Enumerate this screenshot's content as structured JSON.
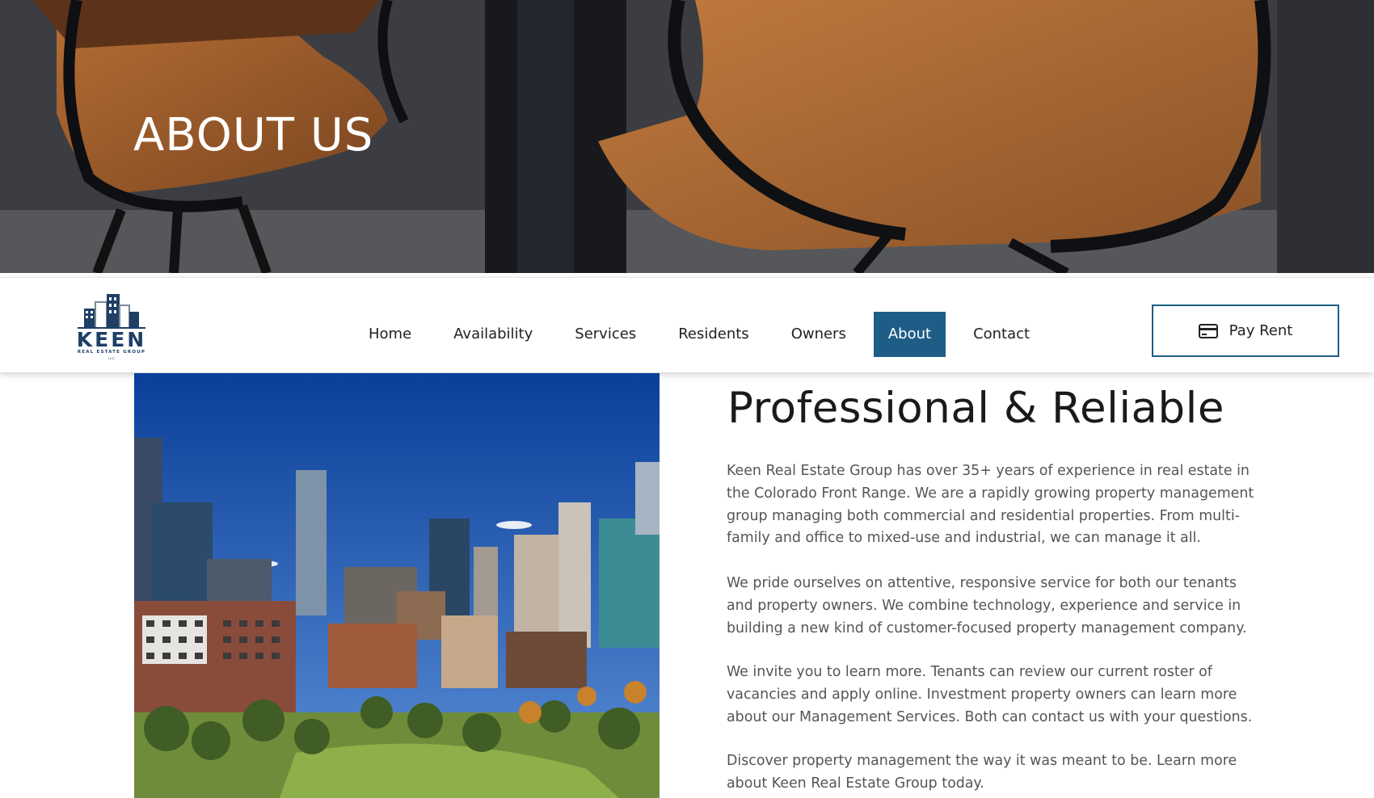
{
  "hero": {
    "title": "ABOUT US"
  },
  "nav": {
    "logo": {
      "word": "KEEN",
      "subtitle": "REAL ESTATE GROUP",
      "suffix": "LLC"
    },
    "items": [
      {
        "label": "Home",
        "active": false
      },
      {
        "label": "Availability",
        "active": false
      },
      {
        "label": "Services",
        "active": false
      },
      {
        "label": "Residents",
        "active": false
      },
      {
        "label": "Owners",
        "active": false
      },
      {
        "label": "About",
        "active": true
      },
      {
        "label": "Contact",
        "active": false
      }
    ],
    "pay_rent": {
      "label": "Pay Rent",
      "icon": "credit-card-icon"
    }
  },
  "about": {
    "title": "Professional & Reliable",
    "paragraphs": [
      "Keen Real Estate Group has over 35+ years of experience in real estate in the Colorado Front Range. We are a rapidly growing property management group managing both commercial and residential properties. From multi-family and office to mixed-use and industrial, we can manage it all.",
      "We pride ourselves on attentive, responsive service for both our tenants and property owners. We combine technology, experience and service in building a new kind of customer-focused property management company.",
      "We invite you to learn more. Tenants can review our current roster of vacancies and apply online. Investment property owners can learn more about our Management Services. Both can contact us with your questions.",
      "Discover property management the way it was meant to be. Learn more about Keen Real Estate Group today."
    ]
  },
  "colors": {
    "accent": "#1e5e86",
    "logo_navy": "#1f3f66",
    "text_dark": "#1a1a1a",
    "text_body": "#555555"
  }
}
